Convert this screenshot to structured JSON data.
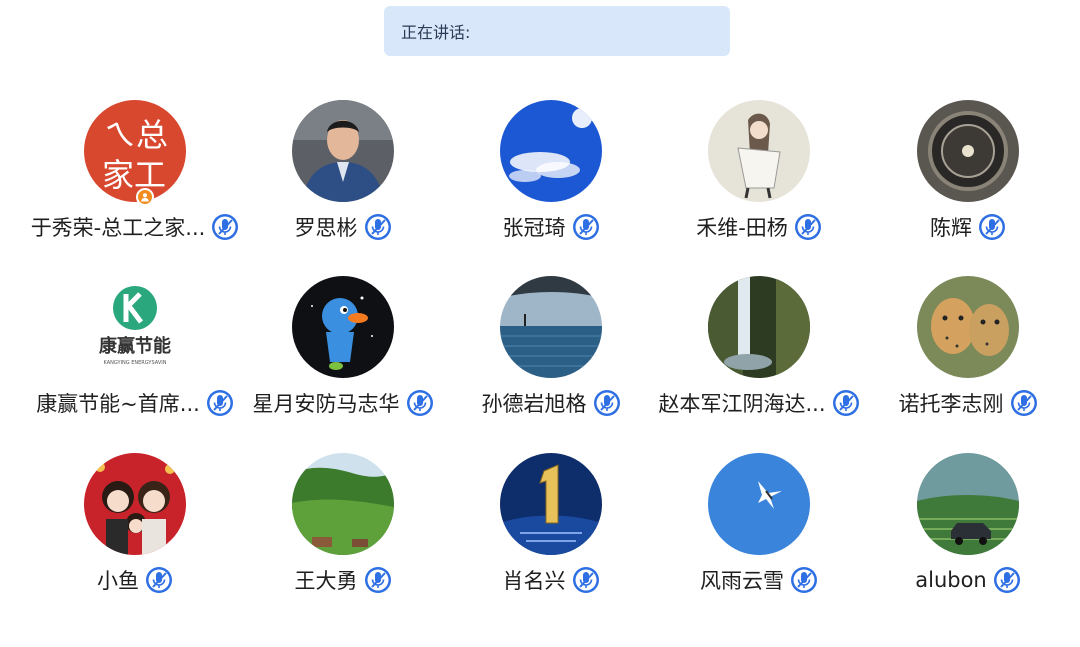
{
  "speaking": {
    "label": "正在讲话:"
  },
  "participants": [
    {
      "name": "于秀荣-总工之家...",
      "avatar": "avatar-calligraphy-logo",
      "is_host": true
    },
    {
      "name": "罗思彬",
      "avatar": "avatar-man-photo"
    },
    {
      "name": "张冠琦",
      "avatar": "avatar-blue-sky"
    },
    {
      "name": "禾维-田杨",
      "avatar": "avatar-anime-girl"
    },
    {
      "name": "陈辉",
      "avatar": "avatar-compass"
    },
    {
      "name": "康赢节能~首席...",
      "avatar": "avatar-kangying-logo",
      "logo_text": "康赢节能",
      "logo_subtext": "KANGYING ENERGYSAVIN"
    },
    {
      "name": "星月安防马志华",
      "avatar": "avatar-cartoon-bird"
    },
    {
      "name": "孙德岩旭格",
      "avatar": "avatar-infinity-pool"
    },
    {
      "name": "赵本军江阴海达...",
      "avatar": "avatar-waterfall"
    },
    {
      "name": "诺托李志刚",
      "avatar": "avatar-cheetahs"
    },
    {
      "name": "小鱼",
      "avatar": "avatar-cartoon-family"
    },
    {
      "name": "王大勇",
      "avatar": "avatar-green-valley"
    },
    {
      "name": "肖名兴",
      "avatar": "avatar-number-one"
    },
    {
      "name": "风雨云雪",
      "avatar": "avatar-seagull"
    },
    {
      "name": "alubon",
      "avatar": "avatar-car-field"
    }
  ],
  "icons": {
    "mic": "microphone-muted-icon",
    "host": "host-person-icon"
  },
  "colors": {
    "speaking_bar_bg": "#d9e7fb",
    "mic_blue": "#2f6fe4",
    "host_badge": "#f28a1e"
  }
}
